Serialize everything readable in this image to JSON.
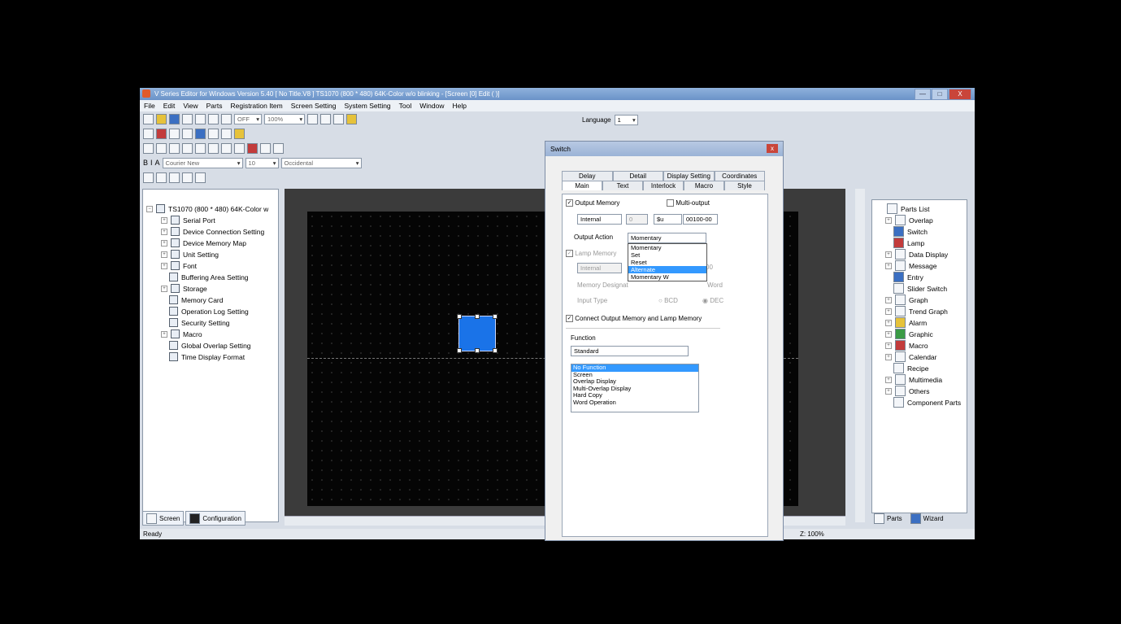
{
  "window": {
    "title": "V Series Editor for Windows Version 5.40 [ No Title.V8 ] TS1070 (800 * 480) 64K-Color w/o blinking - [Screen [0] Edit (        )]",
    "min": "—",
    "max": "□",
    "close": "X"
  },
  "menu": [
    "File",
    "Edit",
    "View",
    "Parts",
    "Registration Item",
    "Screen Setting",
    "System Setting",
    "Tool",
    "Window",
    "Help"
  ],
  "toolbar": {
    "mode_value": "OFF",
    "zoom_value": "100%",
    "language_label": "Language",
    "language_value": "1",
    "font_value": "Courier New",
    "size_value": "10",
    "charset_value": "Occidental"
  },
  "left_tree": {
    "root": "TS1070 (800 * 480) 64K-Color w",
    "items": [
      "Serial Port",
      "Device Connection Setting",
      "Device Memory Map",
      "Unit Setting",
      "Font",
      "Buffering Area Setting",
      "Storage",
      "Memory Card",
      "Operation Log Setting",
      "Security Setting",
      "Macro",
      "Global Overlap Setting",
      "Time Display Format"
    ]
  },
  "left_tabs": {
    "screen": "Screen",
    "config": "Configuration"
  },
  "status": {
    "left": "Ready",
    "zoom": "Z: 100%"
  },
  "right_tree": {
    "items": [
      "Parts List",
      "Overlap",
      "Switch",
      "Lamp",
      "Data Display",
      "Message",
      "Entry",
      "Slider Switch",
      "Graph",
      "Trend Graph",
      "Alarm",
      "Graphic",
      "Macro",
      "Calendar",
      "Recipe",
      "Multimedia",
      "Others",
      "Component Parts"
    ]
  },
  "right_tabs": {
    "parts": "Parts",
    "wizard": "Wizard"
  },
  "dialog": {
    "title": "Switch",
    "tabs_row1": [
      "Delay",
      "Detail",
      "Display Setting",
      "Coordinates"
    ],
    "tabs_row2": [
      "Main",
      "Text",
      "Interlock",
      "Macro",
      "Style"
    ],
    "output_memory_label": "Output Memory",
    "multi_output_label": "Multi-output",
    "memory_type": "Internal",
    "memory_index": "0",
    "memory_prefix": "$u",
    "memory_address": "00100-00",
    "output_action_label": "Output Action",
    "output_action_value": "Momentary",
    "output_action_options": [
      "Momentary",
      "Set",
      "Reset",
      "Alternate",
      "Momentary W"
    ],
    "output_action_selected": "Alternate",
    "lamp_memory_label": "Lamp Memory",
    "lamp_memory_type": "Internal",
    "lamp_address_tail": "00",
    "memory_designation_label": "Memory Designat",
    "word_label": "Word",
    "input_type_label": "Input Type",
    "bcd_label": "BCD",
    "dec_label": "DEC",
    "connect_label": "Connect Output Memory and Lamp Memory",
    "function_label": "Function",
    "function_value": "Standard",
    "function_list": [
      "No Function",
      "Screen",
      "Overlap Display",
      "Multi-Overlap Display",
      "Hard Copy",
      "Word Operation"
    ]
  }
}
